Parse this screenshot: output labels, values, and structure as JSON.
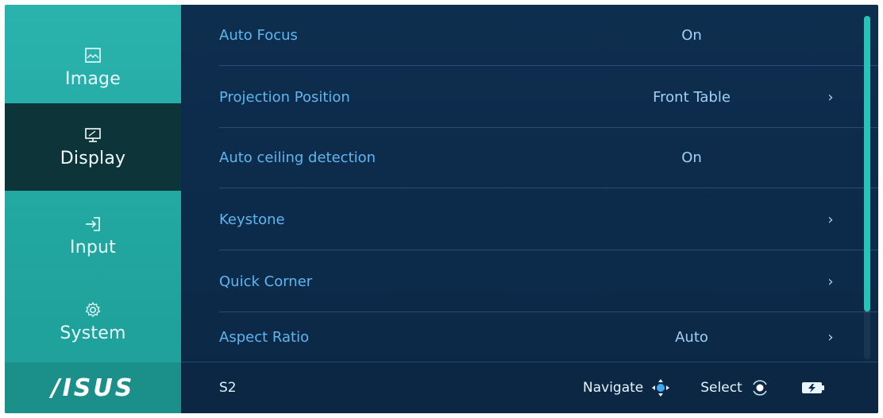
{
  "sidebar": {
    "items": [
      {
        "label": "Image",
        "icon": "image-icon"
      },
      {
        "label": "Display",
        "icon": "display-icon",
        "active": true
      },
      {
        "label": "Input",
        "icon": "input-icon"
      },
      {
        "label": "System",
        "icon": "gear-icon"
      }
    ],
    "logo": "/ISUS"
  },
  "menu": {
    "rows": [
      {
        "label": "Auto Focus",
        "value": "On",
        "arrow": ""
      },
      {
        "label": "Projection Position",
        "value": "Front Table",
        "arrow": "›"
      },
      {
        "label": "Auto ceiling detection",
        "value": "On",
        "arrow": ""
      },
      {
        "label": "Keystone",
        "value": "",
        "arrow": "›"
      },
      {
        "label": "Quick Corner",
        "value": "",
        "arrow": "›"
      },
      {
        "label": "Aspect Ratio",
        "value": "Auto",
        "arrow": "›"
      }
    ]
  },
  "footer": {
    "model": "S2",
    "navigate": "Navigate",
    "select": "Select"
  },
  "colors": {
    "sidebar_teal": "#22a6a0",
    "active_item": "#0d3438",
    "panel_bg": "#0e2e4f",
    "label_blue": "#5fb6ee",
    "scroll_accent": "#27c2b8"
  }
}
